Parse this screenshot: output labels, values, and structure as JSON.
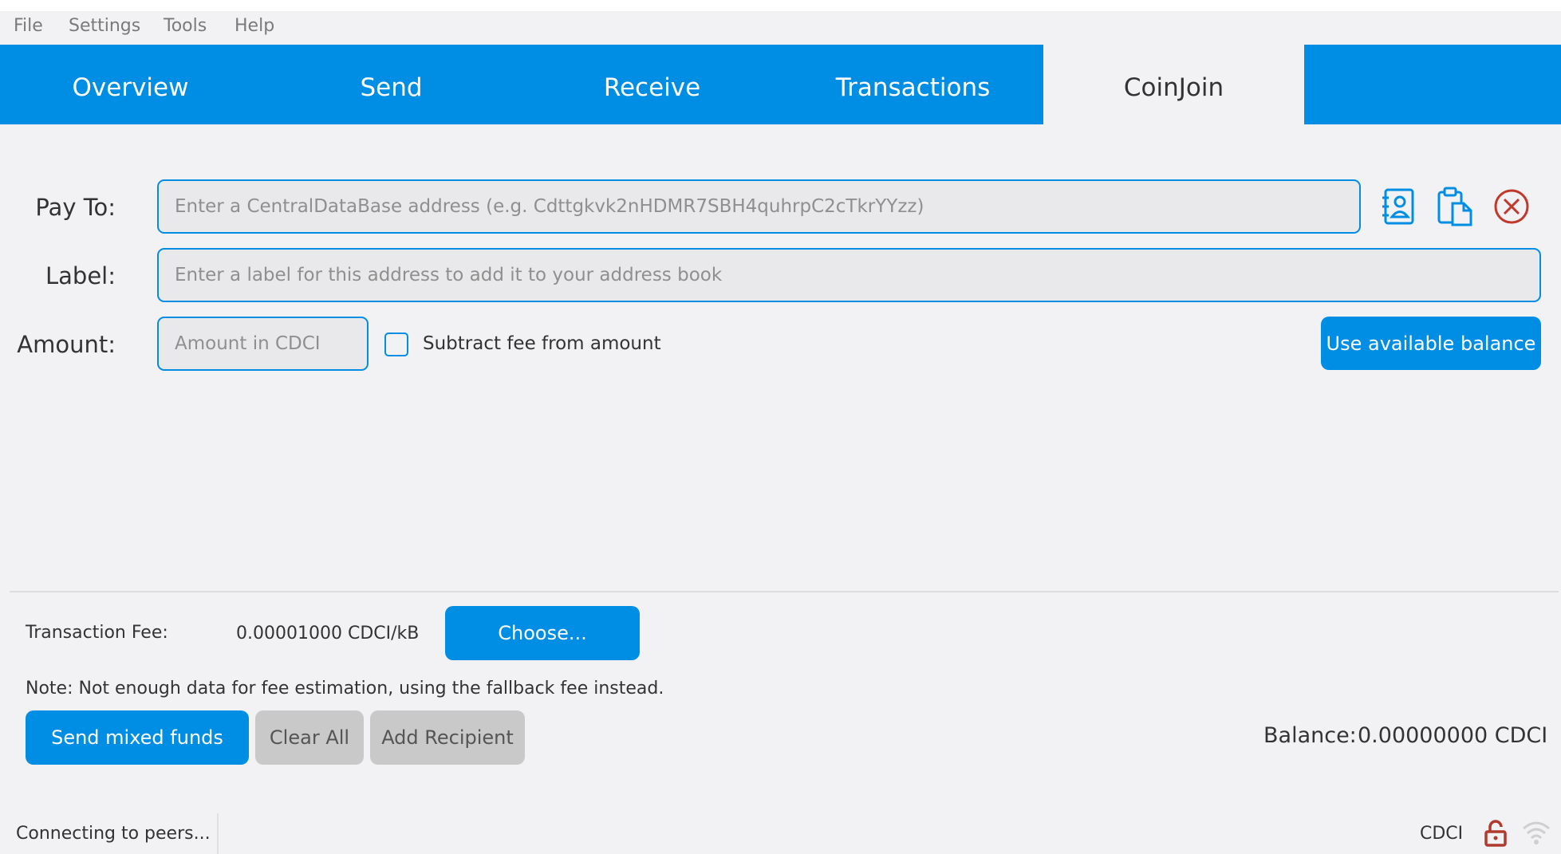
{
  "menu": {
    "items": [
      "File",
      "Settings",
      "Tools",
      "Help"
    ]
  },
  "tabs": [
    {
      "label": "Overview",
      "active": false
    },
    {
      "label": "Send",
      "active": false
    },
    {
      "label": "Receive",
      "active": false
    },
    {
      "label": "Transactions",
      "active": false
    },
    {
      "label": "CoinJoin",
      "active": true
    }
  ],
  "form": {
    "pay_to_label": "Pay To:",
    "pay_to_placeholder": "Enter a CentralDataBase address (e.g. Cdttgkvk2nHDMR7SBH4quhrpC2cTkrYYzz)",
    "label_label": "Label:",
    "label_placeholder": "Enter a label for this address to add it to your address book",
    "amount_label": "Amount:",
    "amount_placeholder": "Amount in CDCI",
    "subtract_fee_label": "Subtract fee from amount",
    "subtract_fee_checked": false,
    "use_balance_label": "Use available balance",
    "icons": [
      "address-book-icon",
      "paste-icon",
      "remove-icon"
    ]
  },
  "fee": {
    "label": "Transaction Fee:",
    "value": "0.00001000 CDCI/kB",
    "choose_label": "Choose...",
    "note": "Note: Not enough data for fee estimation, using the fallback fee instead."
  },
  "actions": {
    "send_label": "Send mixed funds",
    "clear_label": "Clear All",
    "add_label": "Add Recipient"
  },
  "balance": {
    "label": "Balance:",
    "value": "0.00000000 CDCI"
  },
  "status": {
    "text": "Connecting to peers...",
    "unit": "CDCI",
    "icons": [
      "lock-open-icon",
      "network-icon"
    ]
  },
  "colors": {
    "accent": "#008de4",
    "background": "#f2f2f4",
    "remove": "#c0392b",
    "lock": "#b03a2e"
  }
}
